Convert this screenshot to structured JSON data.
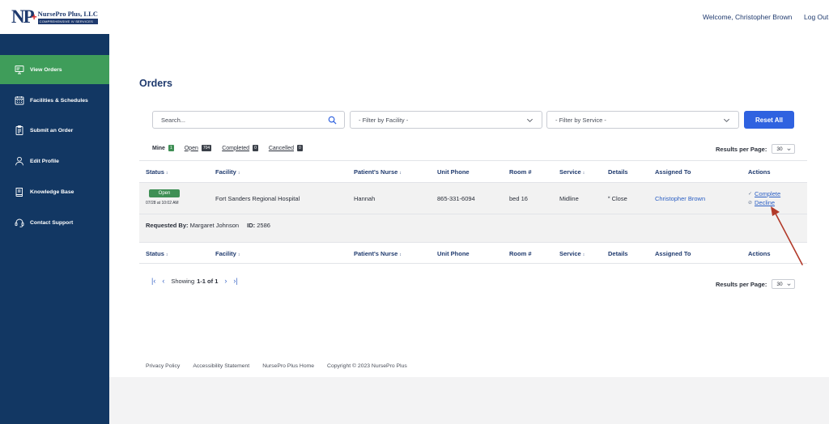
{
  "header": {
    "logo_initials": "NP",
    "logo_plus": "+",
    "logo_title": "NursePro Plus, LLC",
    "logo_subtitle": "COMPREHENSIVE IV SERVICES",
    "welcome": "Welcome, Christopher Brown",
    "logout": "Log Out"
  },
  "sidebar": {
    "items": [
      {
        "label": "View Orders",
        "icon": "monitor-icon",
        "active": true
      },
      {
        "label": "Facilities & Schedules",
        "icon": "calendar-icon"
      },
      {
        "label": "Submit an Order",
        "icon": "clipboard-icon"
      },
      {
        "label": "Edit Profile",
        "icon": "user-icon"
      },
      {
        "label": "Knowledge Base",
        "icon": "book-icon"
      },
      {
        "label": "Contact Support",
        "icon": "headset-icon"
      }
    ]
  },
  "main": {
    "title": "Orders",
    "search_placeholder": "Search...",
    "filter_facility": "- Filter by Facility -",
    "filter_service": "- Filter by Service -",
    "reset_label": "Reset All",
    "tabs": [
      {
        "label": "Mine",
        "count": "1",
        "active": true
      },
      {
        "label": "Open",
        "count": "704"
      },
      {
        "label": "Completed",
        "count": "0"
      },
      {
        "label": "Cancelled",
        "count": "0"
      }
    ],
    "results_per_page_label": "Results per Page:",
    "results_per_page_value": "30"
  },
  "table": {
    "columns": [
      "Status",
      "Facility",
      "Patient's Nurse",
      "Unit Phone",
      "Room #",
      "Service",
      "Details",
      "Assigned To",
      "Actions"
    ],
    "sort_glyph": "↕",
    "row": {
      "status": "Open",
      "time": "07/28 at 10:02 AM",
      "facility": "Fort Sanders Regional Hospital",
      "nurse": "Hannah",
      "phone": "865-331-6094",
      "room": "bed 16",
      "service": "Midline",
      "details": "˟ Close",
      "assigned": "Christopher Brown",
      "action_complete": "Complete",
      "action_decline": "Decline",
      "complete_glyph": "✓",
      "decline_glyph": "⊘",
      "requested_by_label": "Requested By:",
      "requested_by": "Margaret Johnson",
      "id_label": "ID:",
      "id": "2586"
    }
  },
  "pager": {
    "first": "|‹",
    "prev": "‹",
    "next": "›",
    "last": "›|",
    "showing_label": "Showing",
    "range": "1-1 of 1"
  },
  "footer": {
    "privacy": "Privacy Policy",
    "accessibility": "Accessibility Statement",
    "home": "NursePro Plus Home",
    "copyright": "Copyright © 2023 NursePro Plus"
  },
  "colors": {
    "navy": "#123763",
    "active_green": "#3f9d5a",
    "button_blue": "#2f62e0",
    "annotation_red": "#b23a2a"
  }
}
